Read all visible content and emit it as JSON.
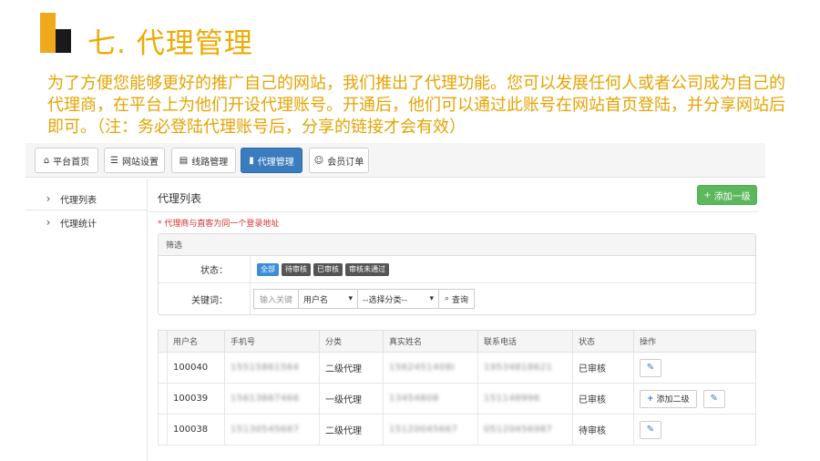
{
  "slide": {
    "title": "七. 代理管理",
    "intro": "为了方便您能够更好的推广自己的网站，我们推出了代理功能。您可以发展任何人或者公司成为自己的代理商，在平台上为他们开设代理账号。开通后，他们可以通过此账号在网站首页登陆，并分享网站后即可。（注：务必登陆代理账号后，分享的链接才会有效）"
  },
  "tabs": [
    {
      "label": "平台首页",
      "icon": "home-icon",
      "glyph": "⌂"
    },
    {
      "label": "网站设置",
      "icon": "list-icon",
      "glyph": "☰"
    },
    {
      "label": "线路管理",
      "icon": "folder-icon",
      "glyph": "▤"
    },
    {
      "label": "代理管理",
      "icon": "bookmark-icon",
      "glyph": "▮"
    },
    {
      "label": "会员订单",
      "icon": "user-icon",
      "glyph": "☺"
    }
  ],
  "sidebar": {
    "items": [
      {
        "label": "代理列表"
      },
      {
        "label": "代理统计"
      }
    ]
  },
  "panel": {
    "title": "代理列表",
    "add_button": "添加一级",
    "note": "* 代理商与直客为同一个登录地址"
  },
  "filter": {
    "heading": "筛选",
    "status_label": "状态：",
    "status_options": [
      "全部",
      "待审核",
      "已审核",
      "审核未通过"
    ],
    "keyword_label": "关键词：",
    "keyword_placeholder": "输入关键",
    "field_select": "用户名",
    "category_select": "--选择分类--",
    "search_button": "查询"
  },
  "table": {
    "headers": [
      "用户名",
      "手机号",
      "分类",
      "真实姓名",
      "联系电话",
      "状态",
      "操作"
    ],
    "rows": [
      {
        "username": "100040",
        "phone": "15515861564",
        "category": "二级代理",
        "realname": "1562451408I",
        "contact": "19534818621",
        "status": "已审核",
        "add_sub": ""
      },
      {
        "username": "100039",
        "phone": "15613887466",
        "category": "一级代理",
        "realname": "13454808",
        "contact": "151148996",
        "status": "已审核",
        "add_sub": "添加二级"
      },
      {
        "username": "100038",
        "phone": "15130545687",
        "category": "二级代理",
        "realname": "15120045667",
        "contact": "05120456987",
        "status": "待审核",
        "add_sub": ""
      }
    ]
  },
  "colors": {
    "title": "#eeaa00",
    "intro": "#e6a300",
    "active_tab": "#3a7cbf",
    "add_button": "#5cb85c",
    "note": "#d9302c"
  }
}
